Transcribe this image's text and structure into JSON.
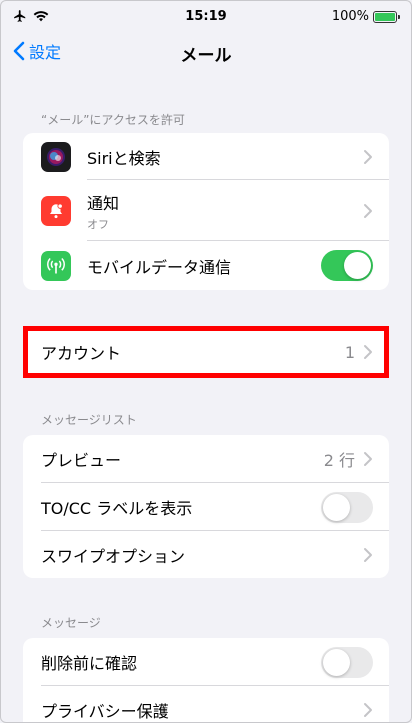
{
  "status_bar": {
    "time": "15:19",
    "battery_text": "100%",
    "icons": [
      "airplane-icon",
      "wifi-icon",
      "battery-charging-icon"
    ]
  },
  "nav": {
    "back_label": "設定",
    "title": "メール"
  },
  "sections": {
    "access": {
      "header": "“メール”にアクセスを許可",
      "rows": [
        {
          "label": "Siriと検索",
          "icon": "siri-icon"
        },
        {
          "label": "通知",
          "sublabel": "オフ",
          "icon": "notification-icon"
        },
        {
          "label": "モバイルデータ通信",
          "icon": "antenna-icon",
          "toggle": true
        }
      ]
    },
    "accounts": {
      "rows": [
        {
          "label": "アカウント",
          "value": "1"
        }
      ]
    },
    "message_list": {
      "header": "メッセージリスト",
      "rows": [
        {
          "label": "プレビュー",
          "value": "2 行"
        },
        {
          "label": "TO/CC ラベルを表示",
          "toggle": false
        },
        {
          "label": "スワイプオプション"
        }
      ]
    },
    "messages": {
      "header": "メッセージ",
      "rows": [
        {
          "label": "削除前に確認",
          "toggle": false
        },
        {
          "label": "プライバシー保護"
        }
      ]
    }
  },
  "colors": {
    "accent": "#007aff",
    "toggle_on": "#34c759",
    "highlight": "#ff0000",
    "siri_bg": "#1c1c1e",
    "notify_bg": "#ff3b30",
    "cellular_bg": "#34c759"
  }
}
